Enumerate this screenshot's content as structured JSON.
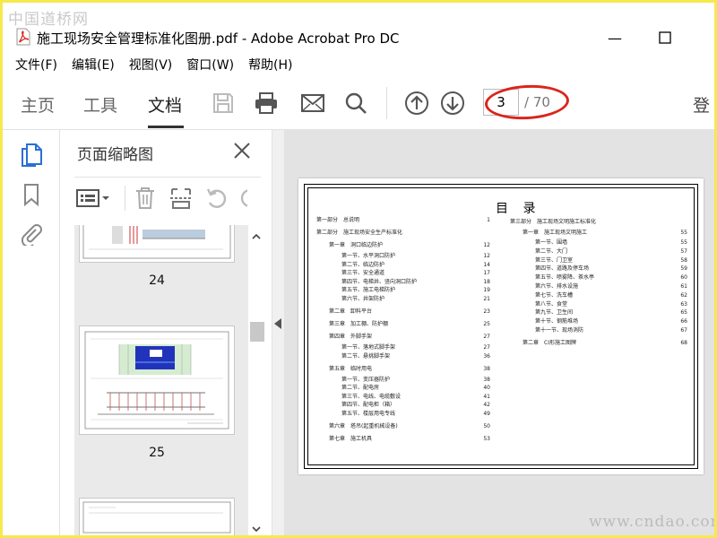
{
  "watermark_top": "中国道桥网",
  "watermark_bottom": "www.cndao.com",
  "window": {
    "title": "施工现场安全管理标准化图册.pdf - Adobe Acrobat Pro DC",
    "minimize": "—",
    "maximize": "☐"
  },
  "menu": [
    "文件(F)",
    "编辑(E)",
    "视图(V)",
    "窗口(W)",
    "帮助(H)"
  ],
  "toolbar": {
    "tabs": [
      "主页",
      "工具",
      "文档"
    ],
    "page_current": "3",
    "page_total": "/ 70",
    "login": "登"
  },
  "panel": {
    "title": "页面缩略图",
    "thumbnails": [
      {
        "label": "24"
      },
      {
        "label": "25"
      }
    ]
  },
  "toc": {
    "title": "目 录",
    "left": [
      {
        "text": "第一部分　总说明",
        "page": "1",
        "level": 0
      },
      {
        "text": "第二部分　施工现场安全生产标准化",
        "page": "",
        "level": 0
      },
      {
        "text": "第一章　洞口临边防护",
        "page": "12",
        "level": 1
      },
      {
        "text": "第一节、水平洞口防护",
        "page": "12",
        "level": 2
      },
      {
        "text": "第二节、临边防护",
        "page": "14",
        "level": 2
      },
      {
        "text": "第三节、安全通道",
        "page": "17",
        "level": 2
      },
      {
        "text": "第四节、电梯井、竖向洞口防护",
        "page": "18",
        "level": 2
      },
      {
        "text": "第五节、施工电梯防护",
        "page": "19",
        "level": 2
      },
      {
        "text": "第六节、井架防护",
        "page": "21",
        "level": 2
      },
      {
        "text": "第二章　卸料平台",
        "page": "23",
        "level": 1
      },
      {
        "text": "第三章　加工棚、防护棚",
        "page": "25",
        "level": 1
      },
      {
        "text": "第四章　外脚手架",
        "page": "27",
        "level": 1
      },
      {
        "text": "第一节、落地式脚手架",
        "page": "27",
        "level": 2
      },
      {
        "text": "第二节、悬挑脚手架",
        "page": "36",
        "level": 2
      },
      {
        "text": "第五章　临时用电",
        "page": "38",
        "level": 1
      },
      {
        "text": "第一节、变压器防护",
        "page": "38",
        "level": 2
      },
      {
        "text": "第二节、配电房",
        "page": "40",
        "level": 2
      },
      {
        "text": "第三节、电线、电缆敷设",
        "page": "41",
        "level": 2
      },
      {
        "text": "第四节、配电柜（箱）",
        "page": "42",
        "level": 2
      },
      {
        "text": "第五节、楼层用电专线",
        "page": "49",
        "level": 2
      },
      {
        "text": "第六章　塔吊(起重机械设备)",
        "page": "50",
        "level": 1
      },
      {
        "text": "第七章　施工机具",
        "page": "53",
        "level": 1
      }
    ],
    "right": [
      {
        "text": "第三部分　施工现场文明施工标准化",
        "page": "",
        "level": 0
      },
      {
        "text": "第一章　施工现场文明施工",
        "page": "55",
        "level": 1
      },
      {
        "text": "第一节、围墙",
        "page": "55",
        "level": 2
      },
      {
        "text": "第二节、大门",
        "page": "57",
        "level": 2
      },
      {
        "text": "第三节、门卫室",
        "page": "58",
        "level": 2
      },
      {
        "text": "第四节、道路及停车场",
        "page": "59",
        "level": 2
      },
      {
        "text": "第五节、喷雾降、茶水亭",
        "page": "60",
        "level": 2
      },
      {
        "text": "第六节、排水设施",
        "page": "61",
        "level": 2
      },
      {
        "text": "第七节、洗车槽",
        "page": "62",
        "level": 2
      },
      {
        "text": "第八节、食堂",
        "page": "63",
        "level": 2
      },
      {
        "text": "第九节、卫生间",
        "page": "65",
        "level": 2
      },
      {
        "text": "第十节、钢筋堆场",
        "page": "66",
        "level": 2
      },
      {
        "text": "第十一节、现场消防",
        "page": "67",
        "level": 2
      },
      {
        "text": "第二章　CI形施工图牌",
        "page": "68",
        "level": 1
      }
    ]
  },
  "colors": {
    "frame": "#f6e94e",
    "highlight_ellipse": "#d9261c",
    "active_rail_icon": "#2a6fd6",
    "doc_background": "#e3e3e3"
  }
}
